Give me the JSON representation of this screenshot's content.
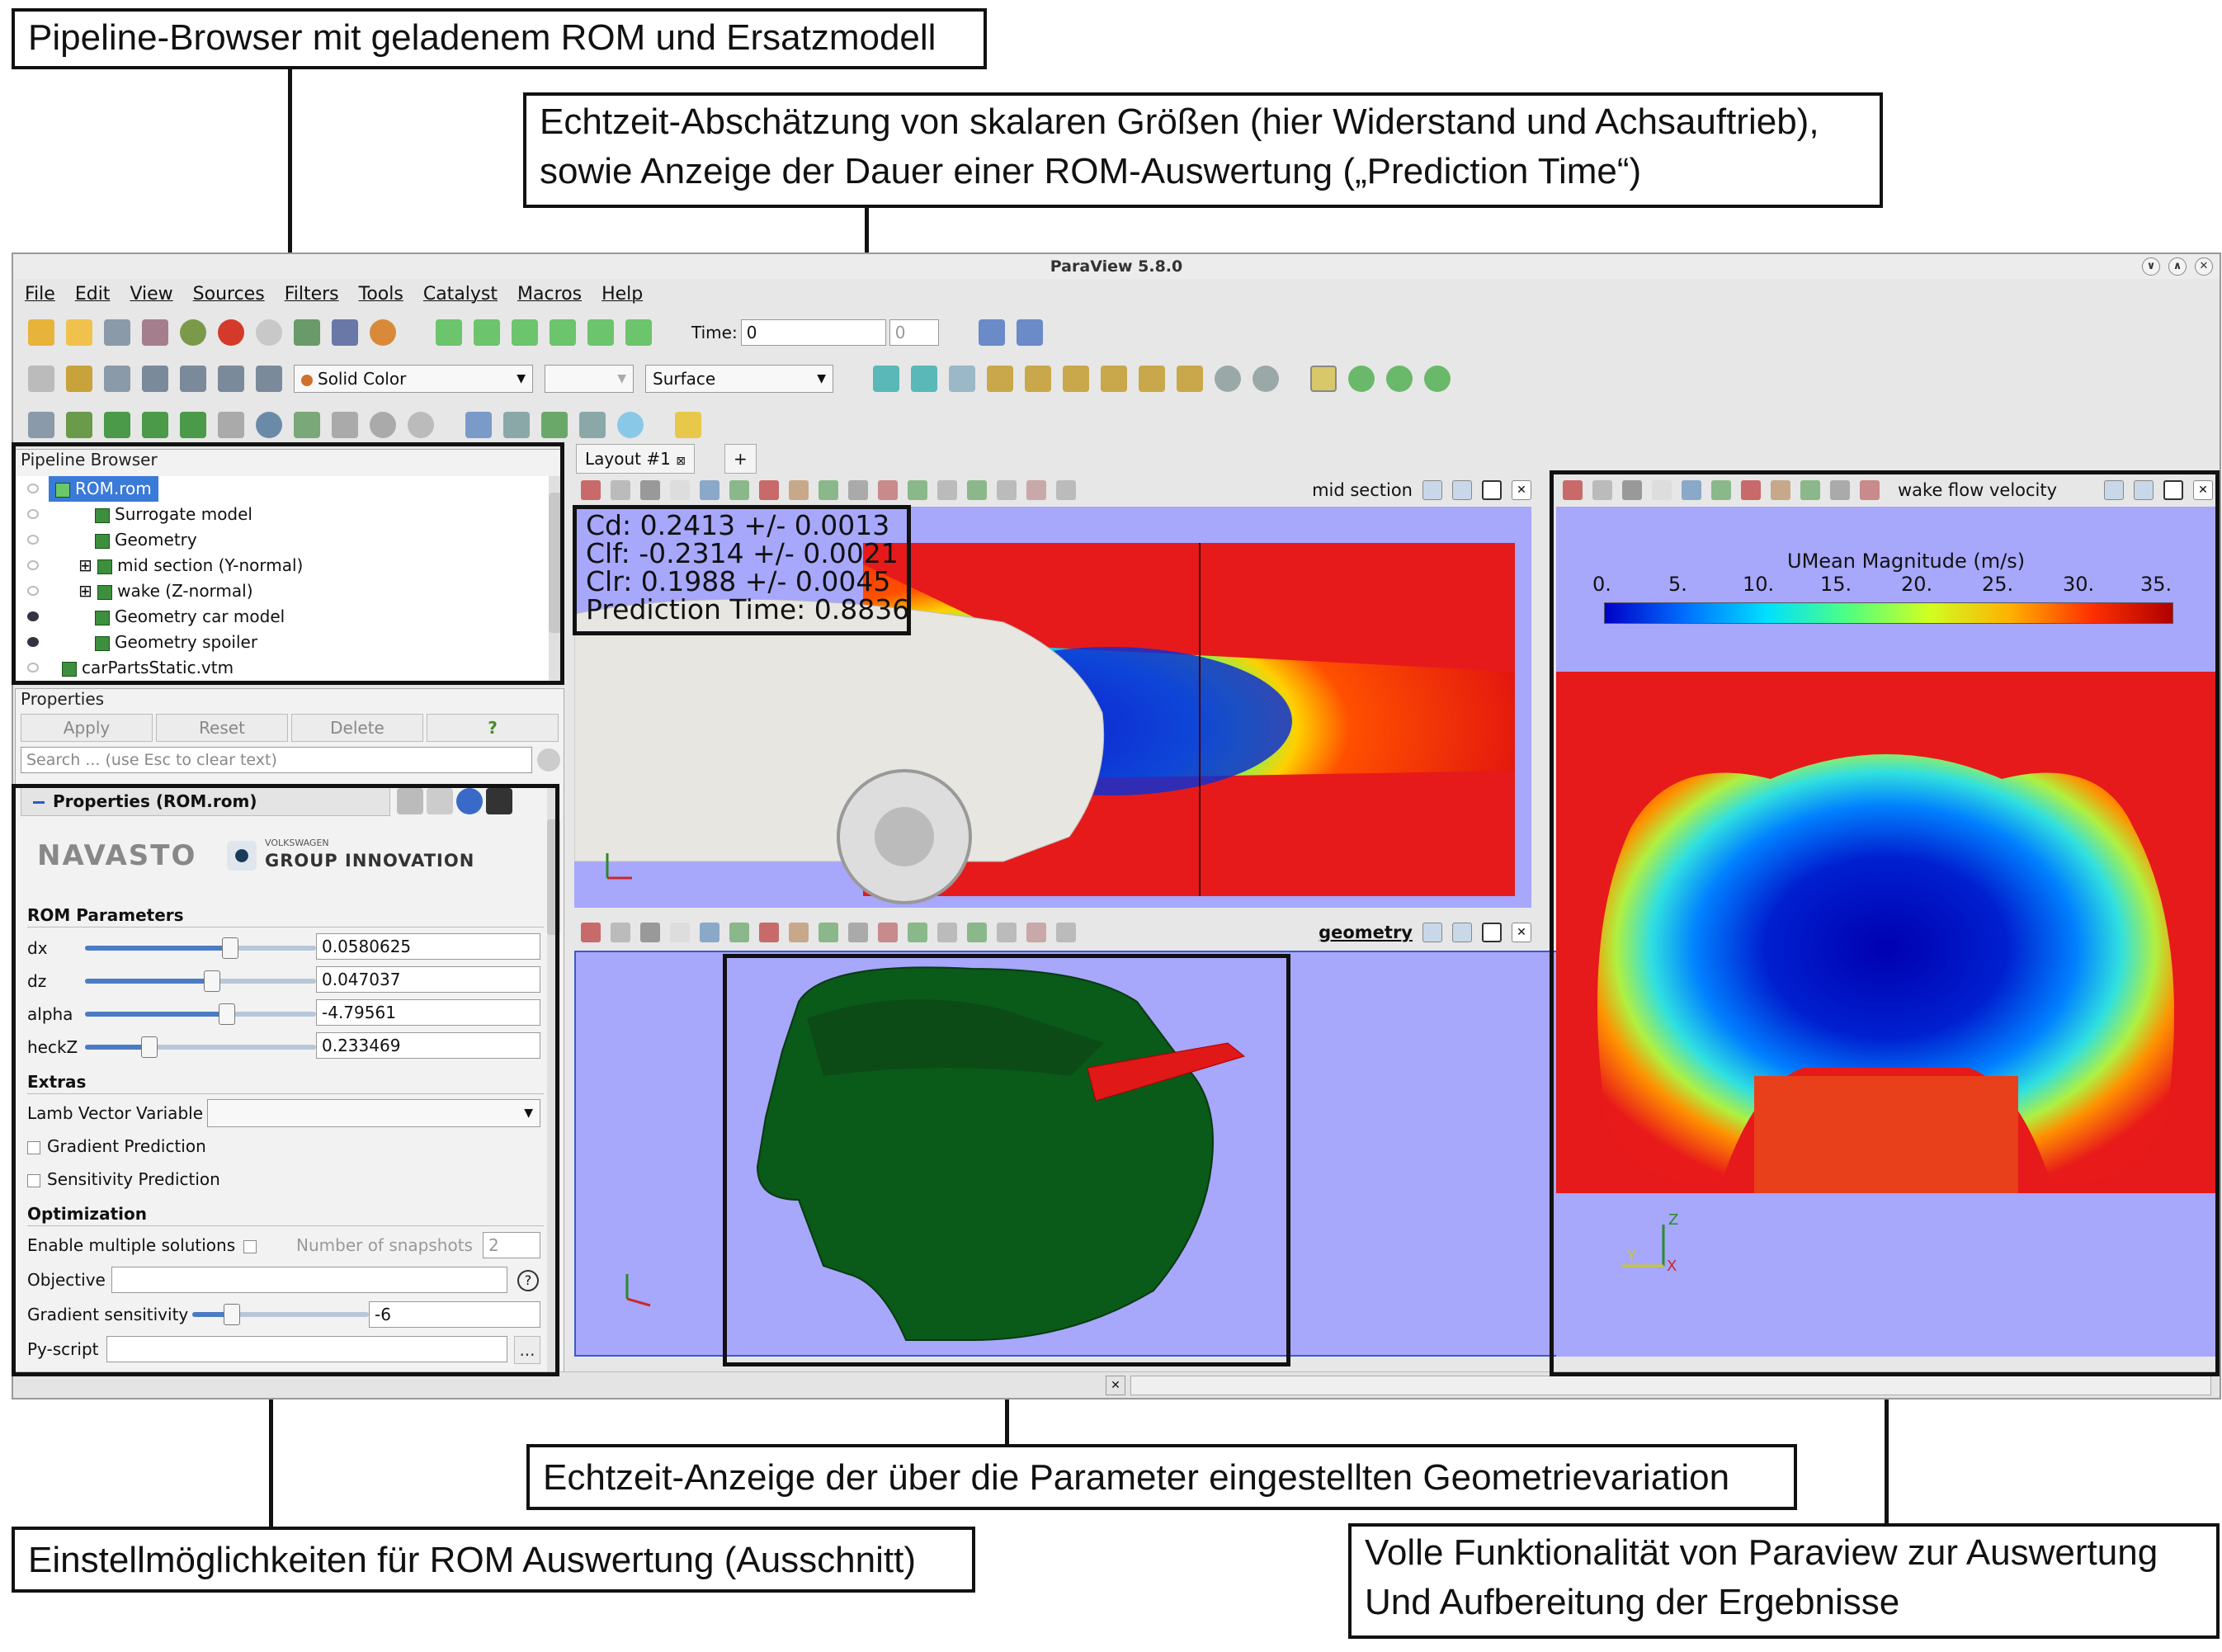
{
  "annotations": {
    "pipeline": "Pipeline-Browser mit geladenem ROM und Ersatzmodell",
    "realtime_line1": "Echtzeit-Abschätzung von skalaren Größen (hier Widerstand und Achsauftrieb),",
    "realtime_line2": "sowie Anzeige der Dauer einer ROM-Auswertung („Prediction Time“)",
    "geometry": "Echtzeit-Anzeige der über die Parameter eingestellten Geometrievariation",
    "settings": "Einstellmöglichkeiten für ROM Auswertung (Ausschnitt)",
    "paraview_line1": "Volle Funktionalität von Paraview zur Auswertung",
    "paraview_line2": "Und Aufbereitung der Ergebnisse"
  },
  "window": {
    "title": "ParaView 5.8.0",
    "menu": [
      "File",
      "Edit",
      "View",
      "Sources",
      "Filters",
      "Tools",
      "Catalyst",
      "Macros",
      "Help"
    ],
    "time_label": "Time:",
    "time_value": "0",
    "time_index": "0",
    "color_mode": "Solid Color",
    "representation": "Surface"
  },
  "pipeline": {
    "title": "Pipeline Browser",
    "items": [
      {
        "label": "ROM.rom",
        "selected": true,
        "visible": false
      },
      {
        "label": "Surrogate model",
        "visible": false
      },
      {
        "label": "Geometry",
        "visible": false
      },
      {
        "label": "mid section (Y-normal)",
        "visible": false
      },
      {
        "label": "wake (Z-normal)",
        "visible": false
      },
      {
        "label": "Geometry car model",
        "visible": true
      },
      {
        "label": "Geometry spoiler",
        "visible": true
      },
      {
        "label": "carPartsStatic.vtm",
        "visible": false
      }
    ]
  },
  "properties": {
    "title": "Properties",
    "apply": "Apply",
    "reset": "Reset",
    "delete": "Delete",
    "help": "?",
    "search_placeholder": "Search ... (use Esc to clear text)",
    "section_title": "Properties (ROM.rom)",
    "logo_left": "NAVASTO",
    "logo_small": "VOLKSWAGEN",
    "logo_right": "GROUP INNOVATION",
    "rom_params_label": "ROM Parameters",
    "params": [
      {
        "name": "dx",
        "value": "0.0580625",
        "pos": 0.65
      },
      {
        "name": "dz",
        "value": "0.047037",
        "pos": 0.55
      },
      {
        "name": "alpha",
        "value": "-4.79561",
        "pos": 0.63
      },
      {
        "name": "heckZ",
        "value": "0.233469",
        "pos": 0.28
      }
    ],
    "extras_label": "Extras",
    "lamb_label": "Lamb Vector Variable",
    "gradient_pred": "Gradient Prediction",
    "sensitivity_pred": "Sensitivity Prediction",
    "optimization_label": "Optimization",
    "multi_solutions": "Enable multiple solutions",
    "snapshots_label": "Number of snapshots",
    "snapshots_value": "2",
    "objective_label": "Objective",
    "gradient_sens_label": "Gradient sensitivity",
    "gradient_sens_value": "-6",
    "pyscript_label": "Py-script",
    "pyscript_btn": "..."
  },
  "layout": {
    "tab": "Layout #1",
    "add": "+",
    "view_mid": "mid section",
    "view_geom": "geometry",
    "view_wake": "wake flow velocity"
  },
  "scalars": {
    "cd": "Cd: 0.2413 +/- 0.0013",
    "clf": "Clf: -0.2314 +/- 0.0021",
    "clr": "Clr: 0.1988 +/- 0.0045",
    "pred": "Prediction Time: 0.8836"
  },
  "colorbar": {
    "title": "UMean Magnitude (m/s)",
    "ticks": [
      "0.",
      "5.",
      "10.",
      "15.",
      "20.",
      "25.",
      "30.",
      "35."
    ],
    "colors": [
      "#0000c8",
      "#0070ff",
      "#00e0ff",
      "#50ff80",
      "#d0ff20",
      "#ffb000",
      "#ff3000",
      "#b00000"
    ]
  },
  "axes": {
    "x": "X",
    "y": "Y",
    "z": "Z"
  }
}
